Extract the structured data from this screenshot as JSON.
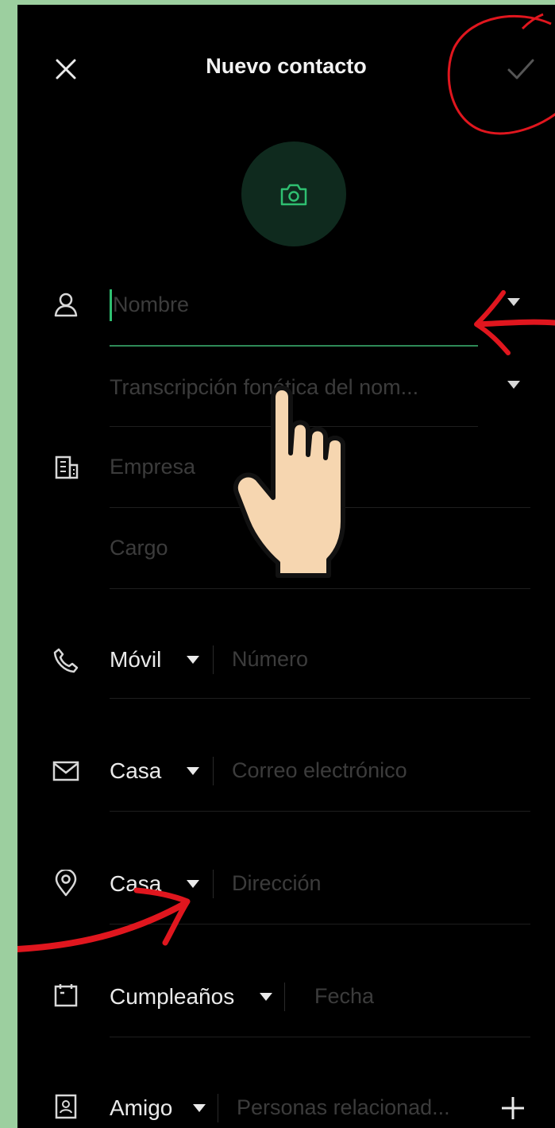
{
  "header": {
    "title": "Nuevo contacto",
    "close_icon": "close-icon",
    "confirm_icon": "check-icon"
  },
  "avatar": {
    "icon": "camera-icon"
  },
  "name_section": {
    "icon": "person-icon",
    "name_placeholder": "Nombre",
    "phonetic_placeholder": "Transcripción fonética del nom..."
  },
  "company_section": {
    "icon": "building-icon",
    "company_placeholder": "Empresa",
    "title_placeholder": "Cargo"
  },
  "phone_section": {
    "icon": "phone-icon",
    "type_label": "Móvil",
    "placeholder": "Número"
  },
  "email_section": {
    "icon": "mail-icon",
    "type_label": "Casa",
    "placeholder": "Correo electrónico"
  },
  "address_section": {
    "icon": "location-pin-icon",
    "type_label": "Casa",
    "placeholder": "Dirección"
  },
  "event_section": {
    "icon": "calendar-icon",
    "type_label": "Cumpleaños",
    "placeholder": "Fecha"
  },
  "relation_section": {
    "icon": "contact-card-icon",
    "type_label": "Amigo",
    "placeholder": "Personas relacionad...",
    "add_icon": "plus-icon"
  },
  "colors": {
    "background": "#000000",
    "accent": "#2fbf71",
    "annotation_red": "#e0161e",
    "outer_frame": "#9ccf9f"
  }
}
